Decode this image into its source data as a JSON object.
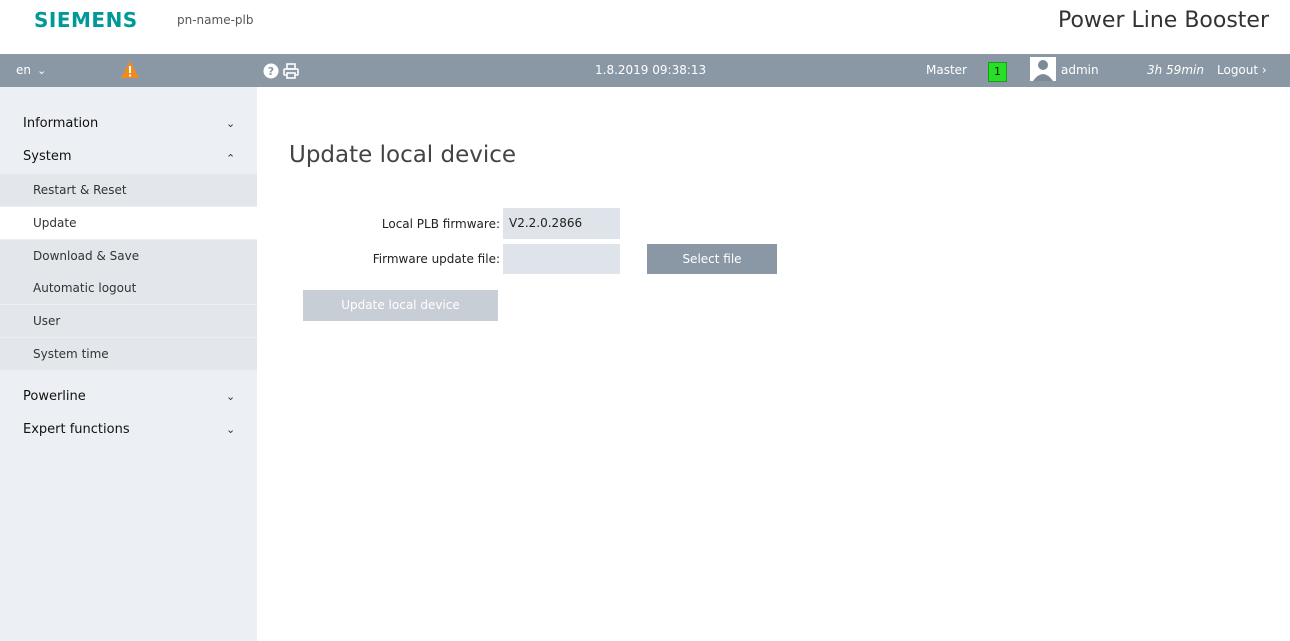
{
  "header": {
    "logo": "SIEMENS",
    "station": "pn-name-plb",
    "product": "Power Line Booster"
  },
  "topbar": {
    "language": "en",
    "datetime": "1.8.2019 09:38:13",
    "role": "Master",
    "master_count": "1",
    "user": "admin",
    "timer": "3h 59min",
    "logout": "Logout",
    "icons": [
      "warning-icon",
      "help-icon",
      "print-icon",
      "user-icon"
    ]
  },
  "sidebar": {
    "information": "Information",
    "system": "System",
    "system_items": [
      "Restart & Reset",
      "Update",
      "Download & Save",
      "Automatic logout",
      "User",
      "System time"
    ],
    "active_item": "Update",
    "powerline": "Powerline",
    "expert": "Expert functions"
  },
  "main": {
    "title": "Update local device",
    "firmware_label": "Local PLB firmware:",
    "firmware_value": "V2.2.0.2866",
    "file_label": "Firmware update file:",
    "file_value": "",
    "select_button": "Select file",
    "update_button": "Update local device"
  },
  "colors": {
    "brand": "#009999",
    "topbar": "#8a98a6",
    "sidebar": "#eceff3",
    "warning": "#f08a1c",
    "master_indicator": "#25e025"
  }
}
